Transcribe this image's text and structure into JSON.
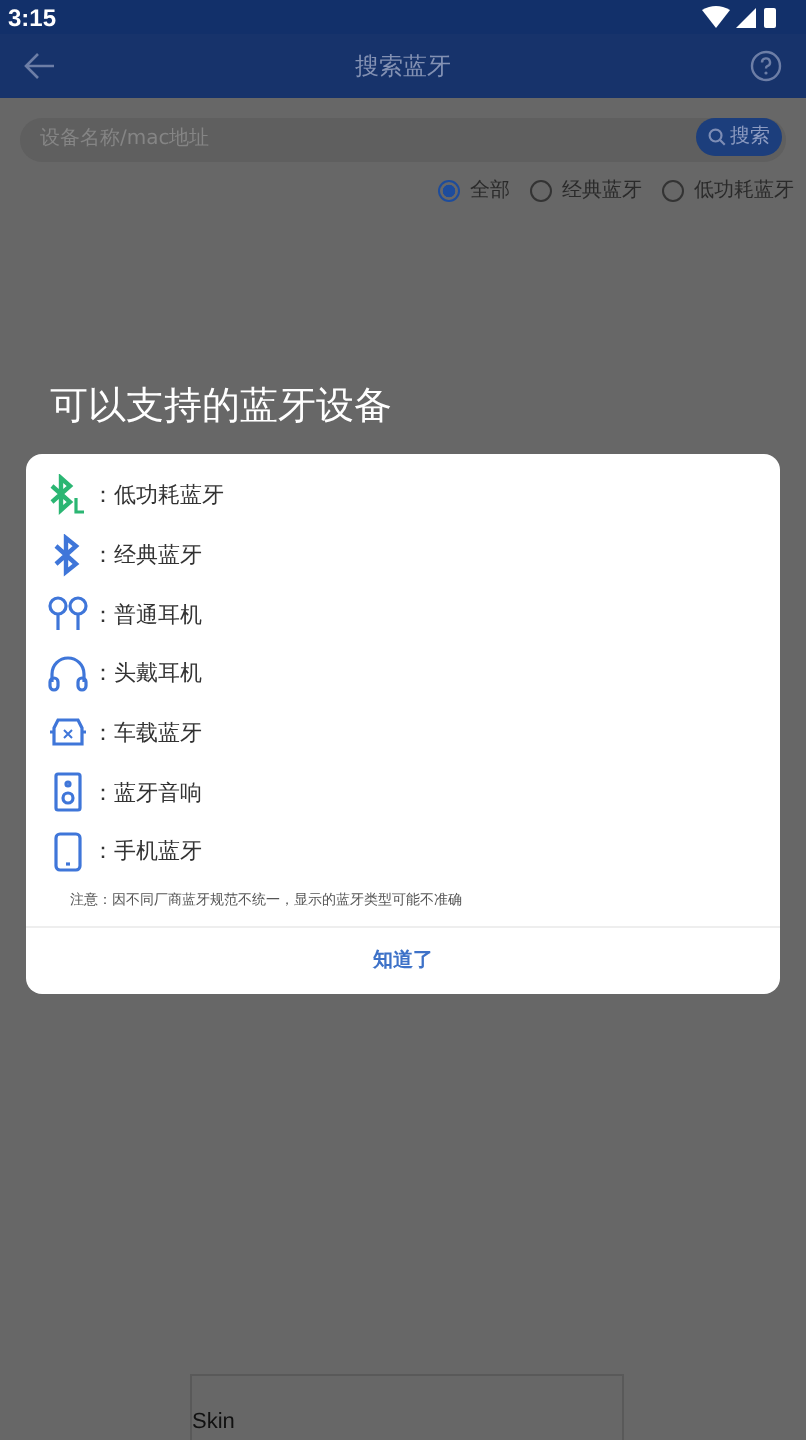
{
  "status_bar": {
    "time": "3:15"
  },
  "toolbar": {
    "title": "搜索蓝牙"
  },
  "search": {
    "placeholder": "设备名称/mac地址",
    "button": "搜索"
  },
  "filters": [
    {
      "label": "全部",
      "selected": true
    },
    {
      "label": "经典蓝牙",
      "selected": false
    },
    {
      "label": "低功耗蓝牙",
      "selected": false
    }
  ],
  "dialog": {
    "heading": "可以支持的蓝牙设备",
    "items": [
      {
        "kind": "ble",
        "label": "：低功耗蓝牙"
      },
      {
        "kind": "classic",
        "label": "：经典蓝牙"
      },
      {
        "kind": "earbuds",
        "label": "：普通耳机"
      },
      {
        "kind": "headphones",
        "label": "：头戴耳机"
      },
      {
        "kind": "car",
        "label": "：车载蓝牙"
      },
      {
        "kind": "speaker",
        "label": "：蓝牙音响"
      },
      {
        "kind": "phone",
        "label": "：手机蓝牙"
      }
    ],
    "note": "注意：因不同厂商蓝牙规范不统一，显示的蓝牙类型可能不准确",
    "button": "知道了"
  },
  "background_panel": {
    "text": "Skin"
  }
}
